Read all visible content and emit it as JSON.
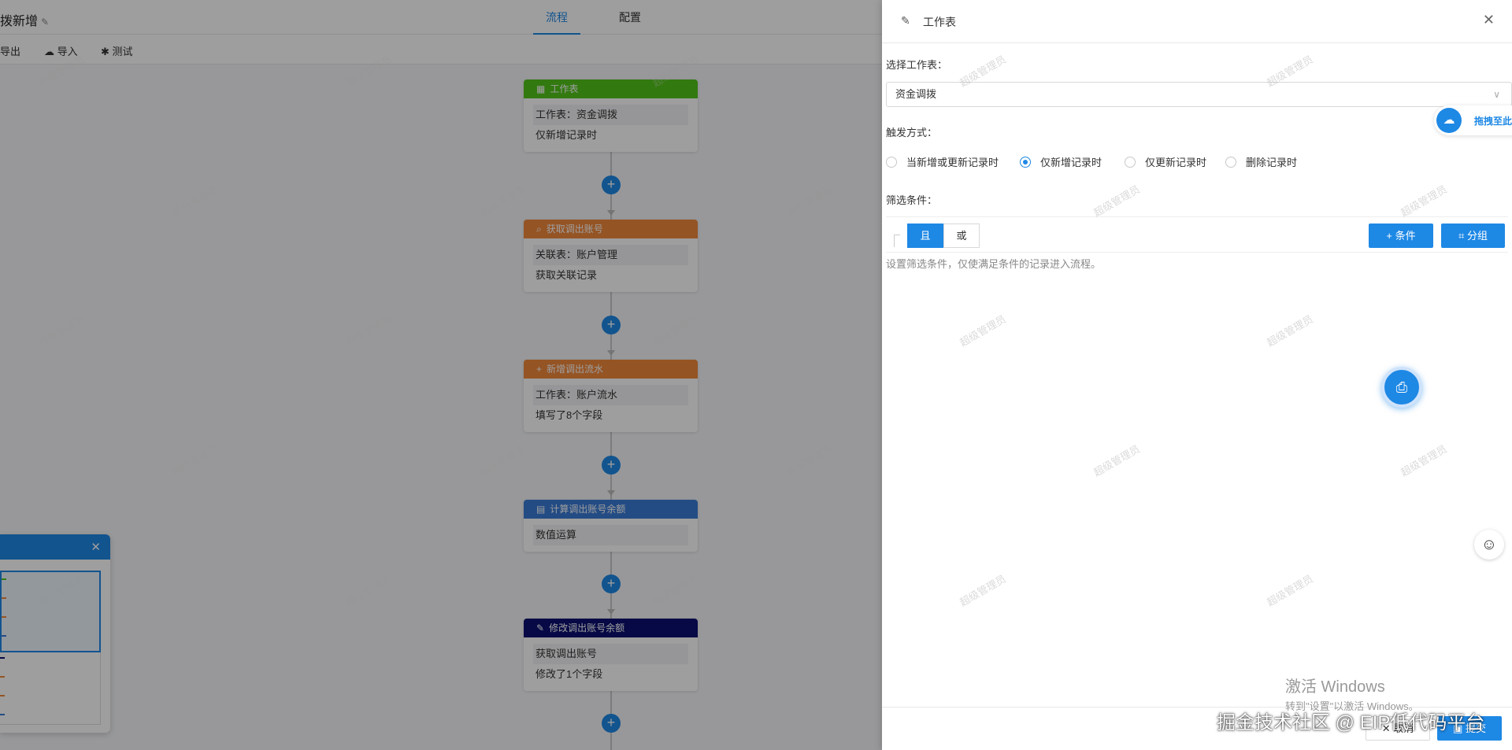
{
  "header": {
    "title": "拨新增",
    "tabs": [
      {
        "label": "流程",
        "active": true
      },
      {
        "label": "配置",
        "active": false
      }
    ]
  },
  "toolbar": {
    "export": "导出",
    "import": "导入",
    "test": "测试"
  },
  "flow_nodes": [
    {
      "title": "工作表",
      "rows": [
        "工作表：资金调拨",
        "仅新增记录时"
      ],
      "color": "#52c41a",
      "icon": "table-icon"
    },
    {
      "title": "获取调出账号",
      "rows": [
        "关联表：账户管理",
        "获取关联记录"
      ],
      "color": "#f0883a",
      "icon": "search-icon"
    },
    {
      "title": "新增调出流水",
      "rows": [
        "工作表：账户流水",
        "填写了8个字段"
      ],
      "color": "#f0883a",
      "icon": "plus-icon"
    },
    {
      "title": "计算调出账号余额",
      "rows": [
        "数值运算"
      ],
      "color": "#3a7bd5",
      "icon": "calculator-icon"
    },
    {
      "title": "修改调出账号余额",
      "rows": [
        "获取调出账号",
        "修改了1个字段"
      ],
      "color": "#0a1070",
      "icon": "pencil-icon"
    }
  ],
  "drawer": {
    "title": "工作表",
    "worksheet_label": "选择工作表：",
    "worksheet_value": "资金调拨",
    "trigger_label": "触发方式：",
    "trigger_options": [
      {
        "label": "当新增或更新记录时",
        "selected": false
      },
      {
        "label": "仅新增记录时",
        "selected": true
      },
      {
        "label": "仅更新记录时",
        "selected": false
      },
      {
        "label": "删除记录时",
        "selected": false
      }
    ],
    "filter_label": "筛选条件：",
    "logic_and": "且",
    "logic_or": "或",
    "add_condition": "+ 条件",
    "add_group": "分组",
    "hint": "设置筛选条件，仅使满足条件的记录进入流程。",
    "drag_text": "拖拽至此",
    "cancel": "取消",
    "submit": "提交"
  },
  "windows_activation": {
    "line1": "激活 Windows",
    "line2": "转到\"设置\"以激活 Windows。"
  },
  "overlay_text": "掘金技术社区 @ EIP低代码平台",
  "watermark": "超级管理员",
  "colors": {
    "accent": "#1e88e5"
  }
}
